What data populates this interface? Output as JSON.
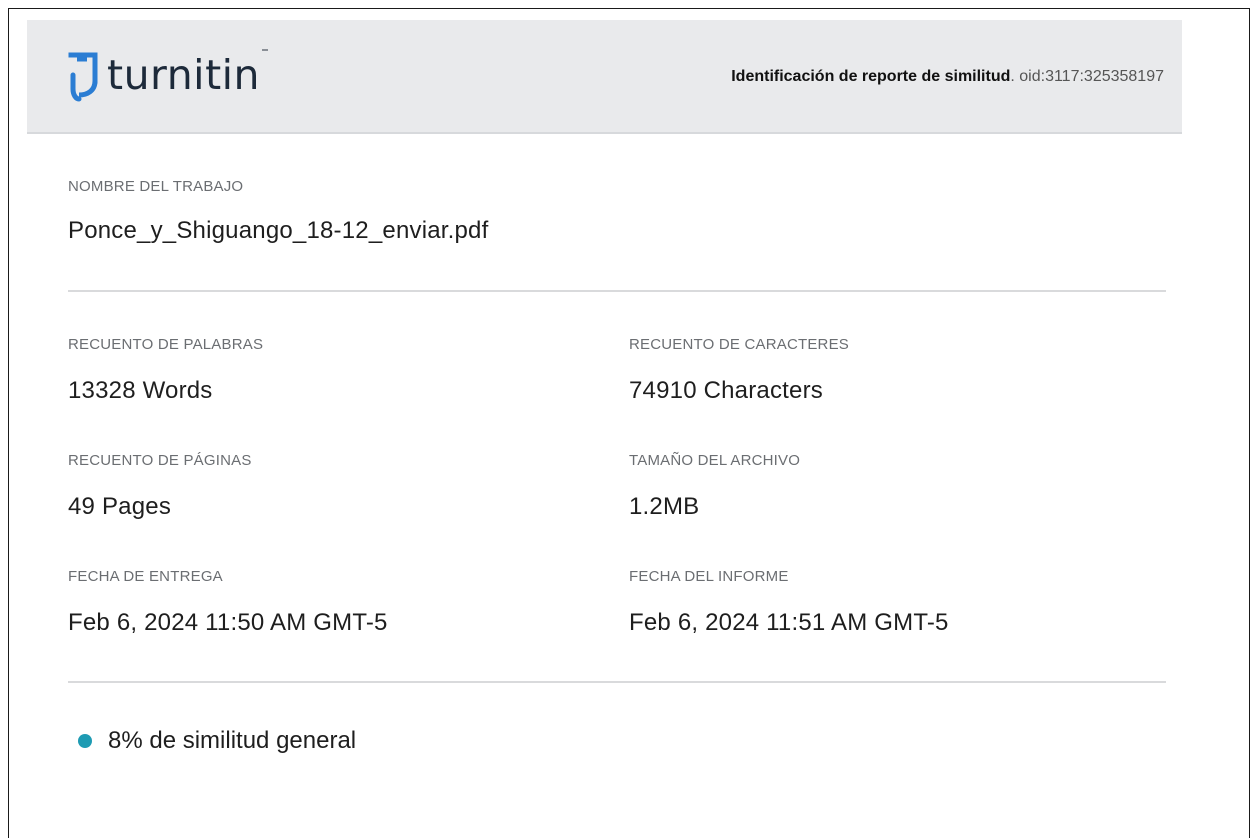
{
  "header": {
    "logo_text": "turnitin",
    "report_label": "Identificación de reporte de similitud",
    "report_id": "oid:3117:325358197"
  },
  "submission": {
    "title_label": "NOMBRE  DEL TRABAJO",
    "title_value": "Ponce_y_Shiguango_18-12_enviar.pdf"
  },
  "details": {
    "word_count_label": "RECUENTO DE PALABRAS",
    "word_count_value": "13328 Words",
    "char_count_label": "RECUENTO  DE CARACTERES",
    "char_count_value": "74910 Characters",
    "page_count_label": "RECUENTO  DE PÁGINAS",
    "page_count_value": "49 Pages",
    "file_size_label": "TAMAÑO DEL ARCHIVO",
    "file_size_value": "1.2MB",
    "submission_date_label": "FECHA DE ENTREGA",
    "submission_date_value": "Feb 6, 2024 11:50 AM GMT-5",
    "report_date_label": "FECHA DEL INFORME",
    "report_date_value": "Feb 6, 2024 11:51 AM GMT-5"
  },
  "similarity": {
    "text": "8% de similitud general",
    "dot_color": "#1e9bb3"
  },
  "colors": {
    "logo_blue": "#2b7dd3",
    "header_bg": "#e9eaec"
  },
  "icons": {
    "logo": "turnitin-logo-icon",
    "status": "similarity-dot-icon"
  }
}
